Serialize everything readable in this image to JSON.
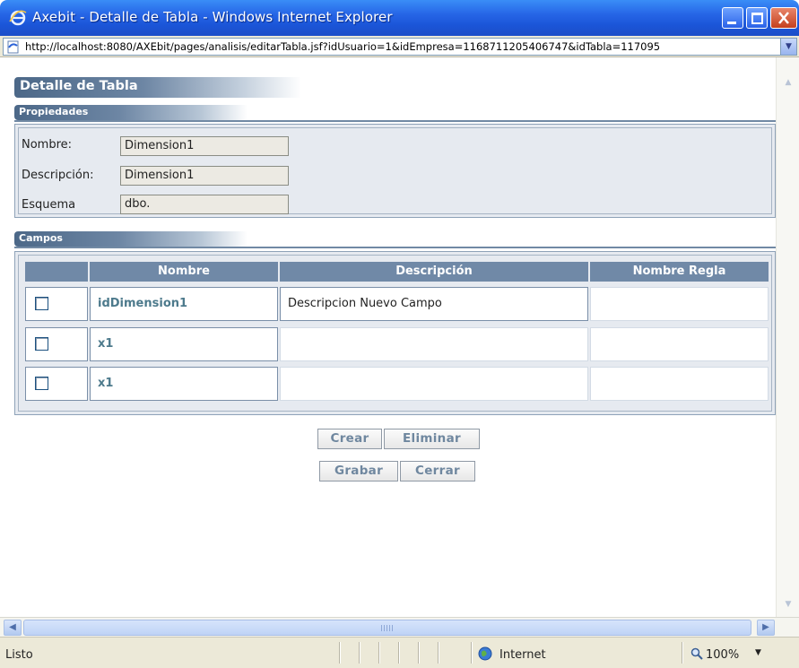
{
  "window": {
    "title": "Axebit - Detalle de Tabla - Windows Internet Explorer"
  },
  "address_bar": {
    "url": "http://localhost:8080/AXEbit/pages/analisis/editarTabla.jsf?idUsuario=1&idEmpresa=1168711205406747&idTabla=117095"
  },
  "page": {
    "title": "Detalle de Tabla",
    "properties_section": {
      "title": "Propiedades",
      "fields": [
        {
          "label": "Nombre:",
          "value": "Dimension1"
        },
        {
          "label": "Descripción:",
          "value": "Dimension1"
        },
        {
          "label": "Esquema",
          "value": "dbo."
        }
      ]
    },
    "fields_section": {
      "title": "Campos",
      "columns": [
        "",
        "Nombre",
        "Descripción",
        "Nombre Regla"
      ],
      "rows": [
        {
          "checked": false,
          "nombre": "idDimension1",
          "descripcion": "Descripcion Nuevo Campo",
          "nombre_regla": ""
        },
        {
          "checked": false,
          "nombre": "x1",
          "descripcion": "",
          "nombre_regla": ""
        },
        {
          "checked": false,
          "nombre": "x1",
          "descripcion": "",
          "nombre_regla": ""
        }
      ]
    },
    "buttons": {
      "crear": "Crear",
      "eliminar": "Eliminar",
      "grabar": "Grabar",
      "cerrar": "Cerrar"
    }
  },
  "status_bar": {
    "status": "Listo",
    "zone": "Internet",
    "zoom": "100%"
  },
  "icons": {
    "title": "ie-logo-icon",
    "address": "page-icon",
    "zone": "globe-icon",
    "zoom": "magnifier-icon"
  }
}
